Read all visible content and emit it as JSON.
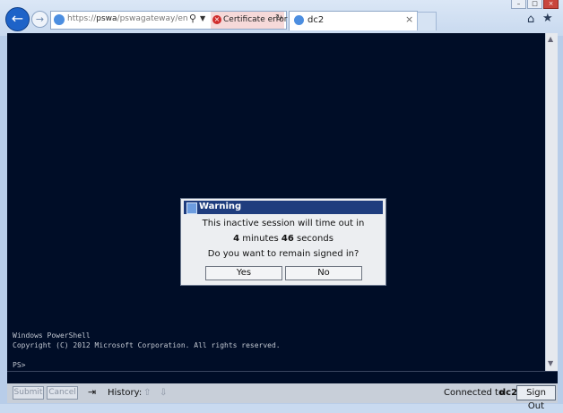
{
  "browser": {
    "url_dim": "https://",
    "url_host": "pswa",
    "url_rest": "/pswagateway/en-US/",
    "cert_error_label": "Certificate error",
    "tab_title": "dc2"
  },
  "console": {
    "lines": [
      "Windows PowerShell",
      "Copyright (C) 2012 Microsoft Corporation. All rights reserved.",
      "",
      "PS>"
    ]
  },
  "toolbar": {
    "submit_label": "Submit",
    "cancel_label": "Cancel",
    "history_label": "History:",
    "connected_label": "Connected to",
    "computer_name": "dc2",
    "signout_label": "Sign Out"
  },
  "dialog": {
    "title": "Warning",
    "line1": "This inactive session will time out in",
    "minutes": "4",
    "minutes_unit": "minutes",
    "seconds": "46",
    "seconds_unit": "seconds",
    "line3": "Do you want to remain signed in?",
    "yes_label": "Yes",
    "no_label": "No"
  },
  "icons": [
    "back-icon",
    "forward-icon",
    "search-icon",
    "refresh-icon",
    "home-icon",
    "star-icon",
    "warning-icon",
    "tab-icon"
  ]
}
